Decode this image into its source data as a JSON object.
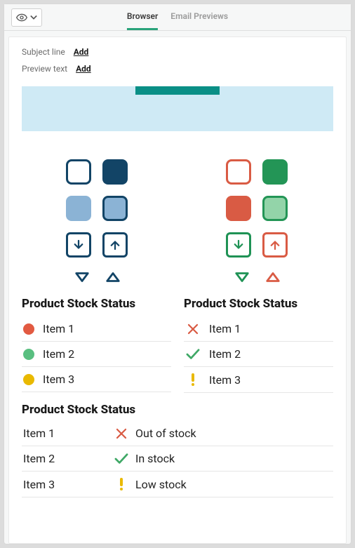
{
  "header": {
    "tabs": [
      "Browser",
      "Email Previews"
    ],
    "active_tab": 0
  },
  "meta": {
    "subject_label": "Subject line",
    "preview_label": "Preview text",
    "add_label": "Add"
  },
  "icon_palettes": [
    {
      "primary": "#124466",
      "secondary": "#8bb3d5"
    },
    {
      "primary": "#239556",
      "secondary": "#93d4a9",
      "alt": "#d95b44"
    }
  ],
  "status_lists": [
    {
      "title": "Product Stock Status",
      "style": "dots",
      "items": [
        {
          "label": "Item 1",
          "status": "out",
          "color": "#e25a41"
        },
        {
          "label": "Item 2",
          "status": "in",
          "color": "#59bf80"
        },
        {
          "label": "Item 3",
          "status": "low",
          "color": "#e9b900"
        }
      ]
    },
    {
      "title": "Product Stock Status",
      "style": "icons",
      "items": [
        {
          "label": "Item 1",
          "status": "out"
        },
        {
          "label": "Item 2",
          "status": "in"
        },
        {
          "label": "Item 3",
          "status": "low"
        }
      ]
    }
  ],
  "status_table": {
    "title": "Product Stock Status",
    "rows": [
      {
        "name": "Item 1",
        "status": "out",
        "status_label": "Out of stock"
      },
      {
        "name": "Item 2",
        "status": "in",
        "status_label": "In stock"
      },
      {
        "name": "Item 3",
        "status": "low",
        "status_label": "Low stock"
      }
    ]
  }
}
